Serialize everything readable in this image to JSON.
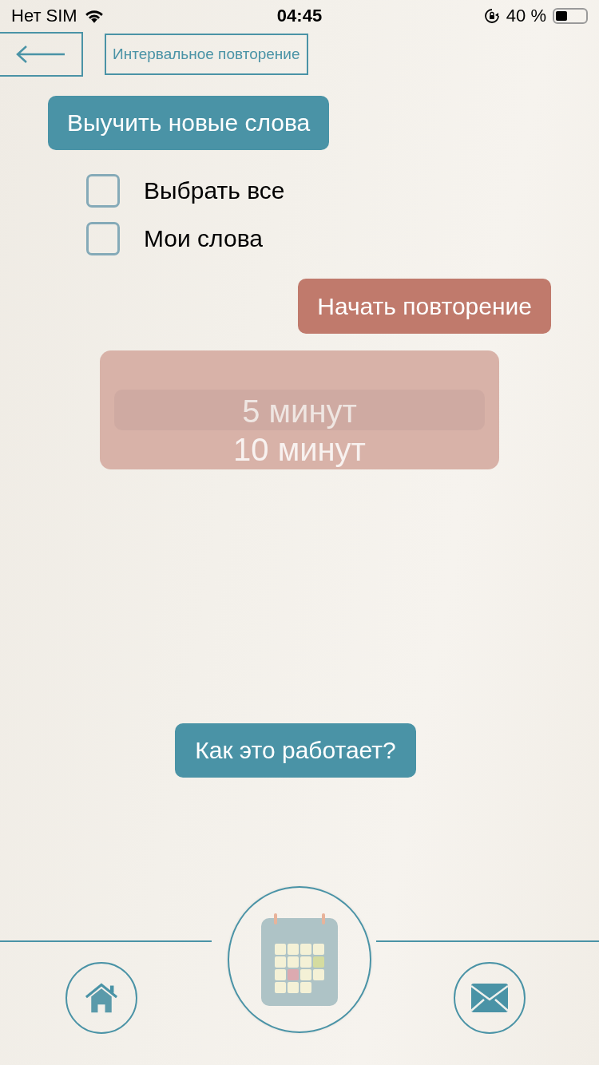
{
  "status_bar": {
    "carrier": "Нет SIM",
    "time": "04:45",
    "battery": "40 %"
  },
  "header": {
    "title": "Интервальное повторение"
  },
  "learn_button": "Выучить новые слова",
  "filters": [
    {
      "label": "Выбрать все",
      "checked": false
    },
    {
      "label": "Мои слова",
      "checked": false
    }
  ],
  "start_button": "Начать повторение",
  "interval_picker": {
    "options": [
      {
        "label": "5 минут",
        "selected": true
      },
      {
        "label": "10 минут",
        "selected": false
      }
    ]
  },
  "help_button": "Как это работает?",
  "tab_bar": {
    "items": [
      {
        "kind": "home",
        "selected": false
      },
      {
        "kind": "calendar",
        "selected": true
      },
      {
        "kind": "mail",
        "selected": false
      }
    ]
  }
}
